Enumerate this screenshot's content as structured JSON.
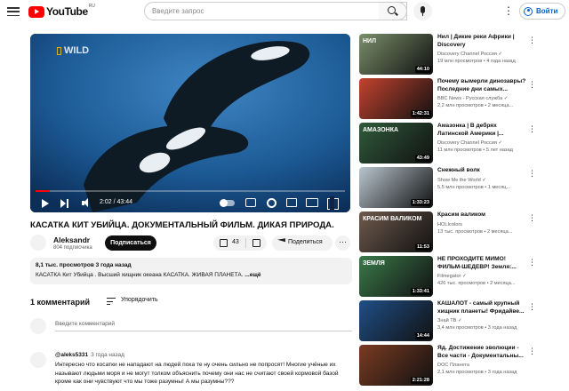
{
  "masthead": {
    "logo_text": "YouTube",
    "logo_country": "RU",
    "search_placeholder": "Введите запрос",
    "signin_label": "Войти",
    "more_dots": "⋮"
  },
  "player": {
    "watermark": "WILD",
    "current_time": "2:02 / 43:44",
    "progress": 0.047
  },
  "video": {
    "title": "КАСАТКА КИТ УБИЙЦА. ДОКУМЕНТАЛЬНЫЙ ФИЛЬМ. ДИКАЯ ПРИРОДА.",
    "channel_name": "Aleksandr",
    "subscribers": "804 подписчика",
    "subscribe_label": "Подписаться",
    "likes": "43",
    "share_label": "Поделиться",
    "more_dots": "···"
  },
  "description": {
    "meta": "8,1 тыс. просмотров  3 года назад",
    "text": "КАСАТКА Кит Убийца . Высший хищник океана КАСАТКА. ЖИВАЯ ПЛАНЕТА. ",
    "more_label": "...ещё"
  },
  "comments": {
    "count_label": "1 комментарий",
    "sort_label": "Упорядочить",
    "add_placeholder": "Введите комментарий",
    "items": [
      {
        "author": "@aleks5331",
        "date": "3 года назад",
        "text": "Интересно что косатки не нападают на людей пока те ну очень сильно не попросят! Многие учёные их называют людьми моря и не могут толком объяснить почему они нас не считают своей кормовой базой кроме как они чувствуют что мы тоже разумны! А мы разумны???"
      }
    ]
  },
  "recommendations": [
    {
      "title": "Нил | Дикие реки Африки | Discovery",
      "channel": "Discovery Channel Россия ✓",
      "meta": "19 млн просмотров • 4 года назад",
      "duration": "44:10",
      "thumb_text": "НИЛ",
      "thumb_color": "#7a8f6a"
    },
    {
      "title": "Почему вымерли динозавры? Последние дни самых...",
      "channel": "BBC News - Русская служба ✓",
      "meta": "2,2 млн просмотров • 2 месяца...",
      "duration": "1:42:31",
      "thumb_text": "",
      "thumb_color": "#c4432f"
    },
    {
      "title": "Амазонка | В дебрях Латинской Америки |...",
      "channel": "Discovery Channel Россия ✓",
      "meta": "11 млн просмотров • 5 лет назад",
      "duration": "43:49",
      "thumb_text": "АМАЗОНКА",
      "thumb_color": "#2f5b3a"
    },
    {
      "title": "Снежный волк",
      "channel": "Show Me the World ✓",
      "meta": "5,5 млн просмотров • 1 месяц...",
      "duration": "1:33:23",
      "thumb_text": "",
      "thumb_color": "#b9c6cf"
    },
    {
      "title": "Красим валиком",
      "channel": "HOLIcolors",
      "meta": "13 тыс. просмотров • 2 месяца...",
      "duration": "11:53",
      "thumb_text": "КРАСИМ ВАЛИКОМ",
      "thumb_color": "#6e5a4c"
    },
    {
      "title": "НЕ ПРОХОДИТЕ МИМО! ФИЛЬМ-ШЕДЕВР! Земля:...",
      "channel": "Filmegator ✓",
      "meta": "426 тыс. просмотров • 2 месяца...",
      "duration": "1:33:41",
      "thumb_text": "ЗЕМЛЯ",
      "thumb_color": "#3a7a4a"
    },
    {
      "title": "КАШАЛОТ - самый крупный хищник планеты! Фридайве...",
      "channel": "Знай ТВ ✓",
      "meta": "3,4 млн просмотров • 3 года назад",
      "duration": "14:44",
      "thumb_text": "",
      "thumb_color": "#1f4f86"
    },
    {
      "title": "Яд. Достижение эволюции - Все части - Документальны...",
      "channel": "DOC Планета",
      "meta": "2,1 млн просмотров • 3 года назад",
      "duration": "2:21:28",
      "thumb_text": "",
      "thumb_color": "#7a3b22"
    }
  ]
}
